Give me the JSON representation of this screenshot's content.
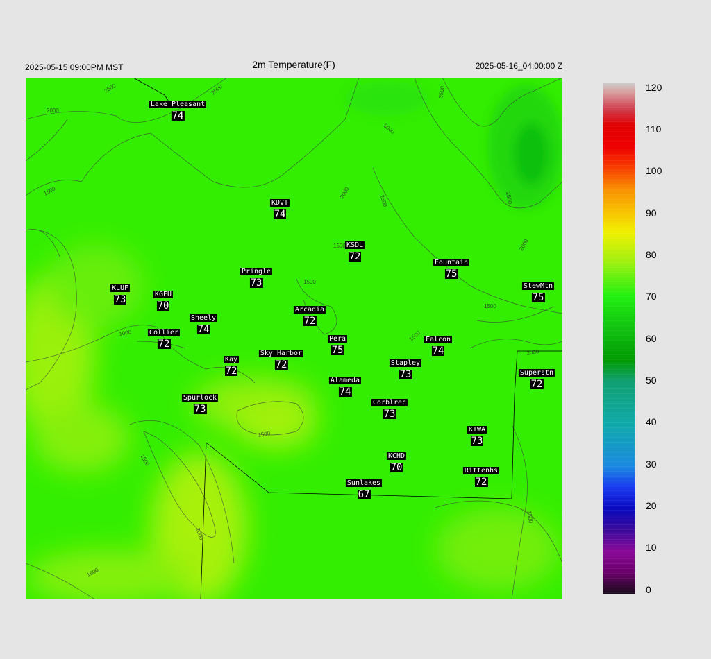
{
  "header": {
    "left_time": "2025-05-15 09:00PM MST",
    "title": "2m Temperature(F)",
    "right_time": "2025-05-16_04:00:00 Z"
  },
  "colors": {
    "page_background": "#e5e5e5",
    "field_base": "#33ee00",
    "warm_patch": "#a6f20a",
    "label_background": "#000000",
    "label_text": "#ffffff"
  },
  "stations": [
    {
      "name": "Lake Pleasant",
      "value": "74"
    },
    {
      "name": "KDVT",
      "value": "74"
    },
    {
      "name": "KSDL",
      "value": "72"
    },
    {
      "name": "Fountain",
      "value": "75"
    },
    {
      "name": "Pringle",
      "value": "73"
    },
    {
      "name": "KLUF",
      "value": "73"
    },
    {
      "name": "KGEU",
      "value": "70"
    },
    {
      "name": "StewMtn",
      "value": "75"
    },
    {
      "name": "Arcadia",
      "value": "72"
    },
    {
      "name": "Sheely",
      "value": "74"
    },
    {
      "name": "Collier",
      "value": "72"
    },
    {
      "name": "Pera",
      "value": "75"
    },
    {
      "name": "Falcon",
      "value": "74"
    },
    {
      "name": "Sky Harbor",
      "value": "72"
    },
    {
      "name": "Kay",
      "value": "72"
    },
    {
      "name": "Stapley",
      "value": "73"
    },
    {
      "name": "Superstn",
      "value": "72"
    },
    {
      "name": "Alameda",
      "value": "74"
    },
    {
      "name": "Spurlock",
      "value": "73"
    },
    {
      "name": "Corblrec",
      "value": "73"
    },
    {
      "name": "KIWA",
      "value": "73"
    },
    {
      "name": "KCHD",
      "value": "70"
    },
    {
      "name": "Rittenhs",
      "value": "72"
    },
    {
      "name": "Sunlakes",
      "value": "67"
    }
  ],
  "contour_labels": [
    "2500",
    "2000",
    "2000",
    "3000",
    "3500",
    "2500",
    "1500",
    "2000",
    "2500",
    "1500",
    "1500",
    "2000",
    "1500",
    "1500",
    "1000",
    "2000",
    "1500",
    "1500",
    "2000",
    "1500",
    "1500"
  ],
  "colorbar": {
    "ticks": [
      "120",
      "110",
      "100",
      "90",
      "80",
      "70",
      "60",
      "50",
      "40",
      "30",
      "20",
      "10",
      "0"
    ],
    "stops": [
      {
        "value": 0,
        "color": "#1a0a1a"
      },
      {
        "value": 5,
        "color": "#6a006a"
      },
      {
        "value": 10,
        "color": "#8a0a9a"
      },
      {
        "value": 15,
        "color": "#3a0a9a"
      },
      {
        "value": 20,
        "color": "#0a0ac0"
      },
      {
        "value": 25,
        "color": "#1a3af0"
      },
      {
        "value": 30,
        "color": "#1a8ae0"
      },
      {
        "value": 40,
        "color": "#10aaaa"
      },
      {
        "value": 50,
        "color": "#10a070"
      },
      {
        "value": 55,
        "color": "#009a00"
      },
      {
        "value": 62,
        "color": "#10c010"
      },
      {
        "value": 70,
        "color": "#20f010"
      },
      {
        "value": 78,
        "color": "#a0f010"
      },
      {
        "value": 85,
        "color": "#f0f000"
      },
      {
        "value": 90,
        "color": "#f8c000"
      },
      {
        "value": 95,
        "color": "#f89000"
      },
      {
        "value": 100,
        "color": "#f84000"
      },
      {
        "value": 105,
        "color": "#f00000"
      },
      {
        "value": 110,
        "color": "#e00000"
      },
      {
        "value": 114,
        "color": "#d04050"
      },
      {
        "value": 118,
        "color": "#d8a0a0"
      },
      {
        "value": 120,
        "color": "#cccccc"
      }
    ]
  }
}
